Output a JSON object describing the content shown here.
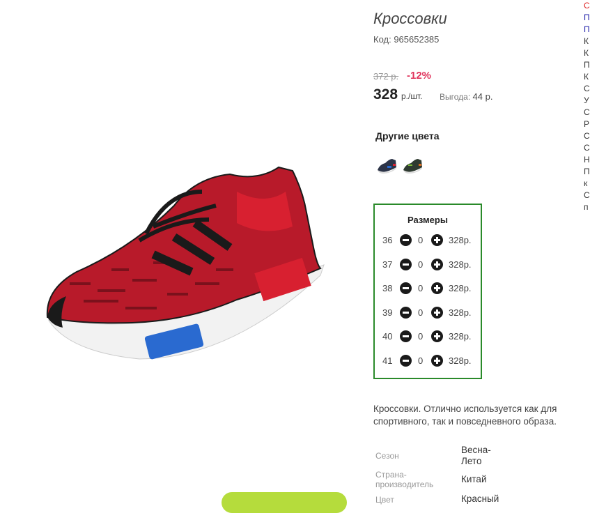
{
  "product": {
    "title": "Кроссовки",
    "code": "Код: 965652385",
    "old_price": "372 р.",
    "discount": "-12%",
    "price": "328",
    "price_unit": "р./шт.",
    "savings_label": "Выгода:",
    "savings_value": "44 р."
  },
  "colors": {
    "title": "Другие цвета",
    "items": [
      {
        "name": "shoe-variant-dark-blue"
      },
      {
        "name": "shoe-variant-dark-green"
      }
    ]
  },
  "sizes": {
    "title": "Размеры",
    "rows": [
      {
        "size": "36",
        "qty": "0",
        "price": "328р."
      },
      {
        "size": "37",
        "qty": "0",
        "price": "328р."
      },
      {
        "size": "38",
        "qty": "0",
        "price": "328р."
      },
      {
        "size": "39",
        "qty": "0",
        "price": "328р."
      },
      {
        "size": "40",
        "qty": "0",
        "price": "328р."
      },
      {
        "size": "41",
        "qty": "0",
        "price": "328р."
      }
    ]
  },
  "description": "Кроссовки. Отлично используется как для спортивного, так и повседневного образа.",
  "attributes": [
    {
      "label": "Сезон",
      "value": "Весна-Лето"
    },
    {
      "label": "Страна-производитель",
      "value": "Китай"
    },
    {
      "label": "Цвет",
      "value": "Красный"
    }
  ],
  "right_column": [
    "С",
    "П",
    "П",
    "К",
    "К",
    "П",
    "К",
    "С",
    "У",
    "С",
    "Р",
    "С",
    "С",
    "Н",
    "П",
    "к",
    "С",
    "п"
  ],
  "colors_palette": {
    "accent_green": "#2a8a2a",
    "discount_red": "#e0355d",
    "cart_green": "#b5dc3c"
  }
}
